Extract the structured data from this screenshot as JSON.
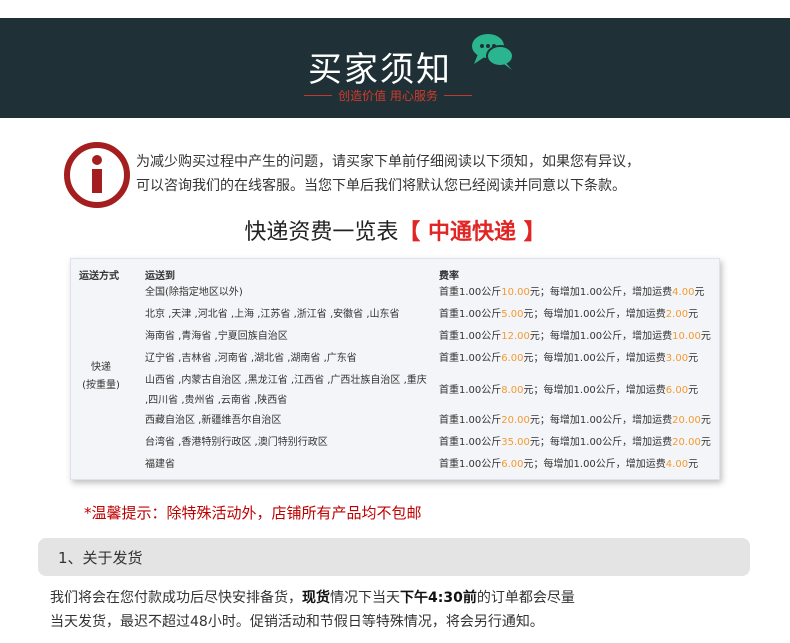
{
  "header": {
    "title": "买家须知",
    "subtitle": "创造价值 用心服务"
  },
  "notice": {
    "line1": "为减少购买过程中产生的问题，请买家下单前仔细阅读以下须知，如果您有异议，",
    "line2": "可以咨询我们的在线客服。当您下单后我们将默认您已经阅读并同意以下条款。"
  },
  "fee_table": {
    "title_prefix": "快递资费一览表",
    "title_highlight": "【 中通快递 】",
    "headers": {
      "method": "运送方式",
      "region": "运送到",
      "fee": "费率"
    },
    "method_line1": "快递",
    "method_line2": "(按重量)",
    "rows": [
      {
        "region": "全国(除指定地区以外)",
        "first": "10.00",
        "extra": "4.00"
      },
      {
        "region": "北京 ,天津 ,河北省 ,上海 ,江苏省 ,浙江省 ,安徽省 ,山东省",
        "first": "5.00",
        "extra": "2.00"
      },
      {
        "region": "海南省 ,青海省 ,宁夏回族自治区",
        "first": "12.00",
        "extra": "10.00"
      },
      {
        "region": "辽宁省 ,吉林省 ,河南省 ,湖北省 ,湖南省 ,广东省",
        "first": "6.00",
        "extra": "3.00"
      },
      {
        "region": "山西省 ,内蒙古自治区 ,黑龙江省 ,江西省 ,广西壮族自治区 ,重庆",
        "region2": ",四川省 ,贵州省 ,云南省 ,陕西省",
        "first": "8.00",
        "extra": "6.00"
      },
      {
        "region": "西藏自治区 ,新疆维吾尔自治区",
        "first": "20.00",
        "extra": "20.00"
      },
      {
        "region": "台湾省 ,香港特别行政区 ,澳门特别行政区",
        "first": "35.00",
        "extra": "20.00"
      },
      {
        "region": "福建省",
        "first": "6.00",
        "extra": "4.00"
      }
    ],
    "fee_text": {
      "p1": "首重1.00公斤",
      "p2": "元；每增加1.00公斤，增加运费",
      "p3": "元"
    }
  },
  "tip": "*温馨提示：除特殊活动外，店铺所有产品均不包邮",
  "section1": {
    "title": "1、关于发货",
    "line1_a": "我们将会在您付款成功后尽快安排备货，",
    "line1_b": "现货",
    "line1_c": "情况下当天",
    "line1_d": "下午4:30前",
    "line1_e": "的订单都会尽量",
    "line2": "当天发货，最迟不超过48小时。促销活动和节假日等特殊情况，将会另行通知。"
  },
  "colors": {
    "header_bg": "#1f3137",
    "accent_red": "#e12525",
    "highlight_orange": "#f29b30",
    "chat_green": "#2bb58f"
  }
}
